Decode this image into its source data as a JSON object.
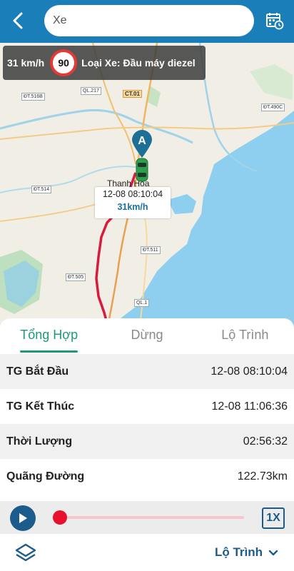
{
  "search": {
    "placeholder": "Xe"
  },
  "speed_panel": {
    "current_speed": "31 km/h",
    "speed_limit": "90",
    "vehicle_type": "Loại Xe: Đầu máy diezel"
  },
  "map": {
    "city": "Thanh Hóa",
    "marker_letter": "A",
    "road_labels": [
      "ĐT.516B",
      "QL.217",
      "CT.01",
      "ĐT.490C",
      "ĐT.514",
      "ĐT.511",
      "ĐT.505",
      "QL.1"
    ],
    "popup": {
      "time": "12-08 08:10:04",
      "speed": "31km/h"
    }
  },
  "tabs": [
    {
      "label": "Tổng Hợp",
      "active": true
    },
    {
      "label": "Dừng",
      "active": false
    },
    {
      "label": "Lộ Trình",
      "active": false
    }
  ],
  "summary": [
    {
      "label": "TG Bắt Đầu",
      "value": "12-08 08:10:04"
    },
    {
      "label": "TG Kết Thúc",
      "value": "12-08 11:06:36"
    },
    {
      "label": "Thời Lượng",
      "value": "02:56:32"
    },
    {
      "label": "Quãng Đường",
      "value": "122.73km"
    }
  ],
  "player": {
    "speed": "1X",
    "progress": 0
  },
  "bottom": {
    "route_select": "Lộ Trình"
  },
  "colors": {
    "primary": "#1a7fb8",
    "accent_tab": "#1a9a7a",
    "route": "#d81b3c",
    "dark_blue": "#1b5c8c"
  }
}
